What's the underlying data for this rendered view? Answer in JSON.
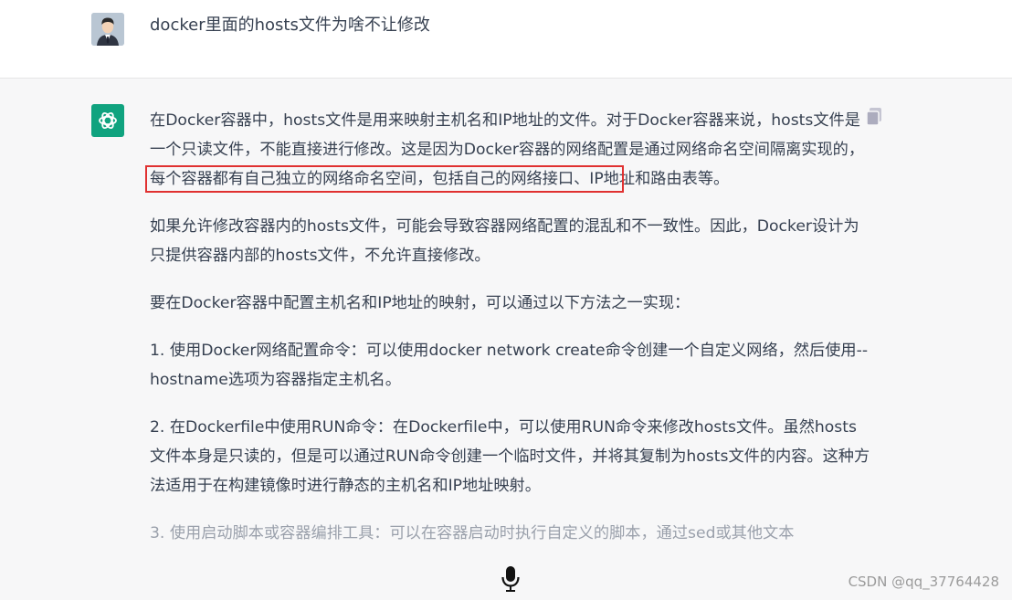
{
  "question": "docker里面的hosts文件为啥不让修改",
  "answer": {
    "p1_a": "在Docker容器中，hosts文件是用来映射主机名和IP地址的文件。对于Docker容器来说，hosts文件是一个只读文件，不能直接进行修改。这是因为Docker容器的网络配置是通过网络命名空间隔离实现的，",
    "p1_highlight": "每个容器都有自己独立的网络命名空间，包括自己的网络接口、IP地",
    "p1_b": "址和路由表等。",
    "p2": "如果允许修改容器内的hosts文件，可能会导致容器网络配置的混乱和不一致性。因此，Docker设计为只提供容器内部的hosts文件，不允许直接修改。",
    "p3": "要在Docker容器中配置主机名和IP地址的映射，可以通过以下方法之一实现：",
    "p4": "1. 使用Docker网络配置命令：可以使用docker network create命令创建一个自定义网络，然后使用--hostname选项为容器指定主机名。",
    "p5": "2. 在Dockerfile中使用RUN命令：在Dockerfile中，可以使用RUN命令来修改hosts文件。虽然hosts文件本身是只读的，但是可以通过RUN命令创建一个临时文件，并将其复制为hosts文件的内容。这种方法适用于在构建镜像时进行静态的主机名和IP地址映射。",
    "p6": "3. 使用启动脚本或容器编排工具：可以在容器启动时执行自定义的脚本，通过sed或其他文本"
  },
  "watermark": "CSDN @qq_37764428",
  "icons": {
    "user_avatar": "user-avatar-icon",
    "bot_avatar": "openai-logo-icon",
    "copy": "copy-icon",
    "mic": "microphone-icon"
  },
  "colors": {
    "bot_avatar_bg": "#10a37f",
    "highlight_border": "#e03131",
    "page_bg": "#f7f7f8"
  }
}
